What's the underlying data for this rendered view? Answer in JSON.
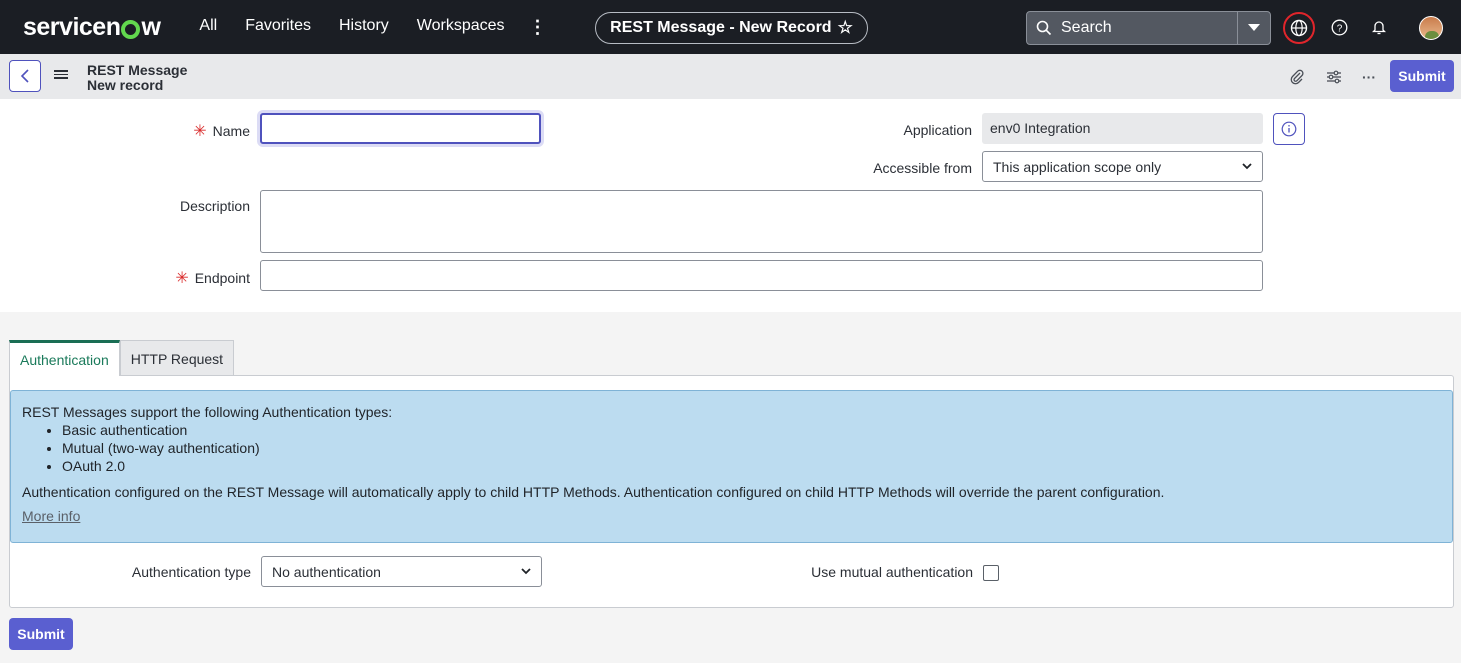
{
  "nav": {
    "logo_pre": "servicen",
    "logo_post": "w",
    "menu": [
      "All",
      "Favorites",
      "History",
      "Workspaces"
    ],
    "kebab": "⋮",
    "record_title": "REST Message - New Record",
    "star": "☆",
    "search_label": "Search"
  },
  "header": {
    "crumb_title": "REST Message",
    "crumb_sub": "New record",
    "more": "···",
    "submit_label": "Submit"
  },
  "form": {
    "name_label": "Name",
    "name_value": "",
    "application_label": "Application",
    "application_value": "env0 Integration",
    "accessible_label": "Accessible from",
    "accessible_value": "This application scope only",
    "description_label": "Description",
    "endpoint_label": "Endpoint",
    "required_mark": "✳"
  },
  "tabs": [
    "Authentication",
    "HTTP Request"
  ],
  "auth": {
    "intro": "REST Messages support the following Authentication types:",
    "types": [
      "Basic authentication",
      "Mutual (two-way authentication)",
      "OAuth 2.0"
    ],
    "note": "Authentication configured on the REST Message will automatically apply to child HTTP Methods. Authentication configured on child HTTP Methods will override the parent configuration.",
    "more_info": "More info",
    "auth_type_label": "Authentication type",
    "auth_type_value": "No authentication",
    "mutual_label": "Use mutual authentication",
    "mutual_checked": false
  },
  "footer": {
    "submit_label": "Submit"
  },
  "colors": {
    "accent": "#5a5fd0",
    "nav_bg": "#1b1e24",
    "info_bg": "#bcdcf0",
    "required": "#d92b2b"
  }
}
